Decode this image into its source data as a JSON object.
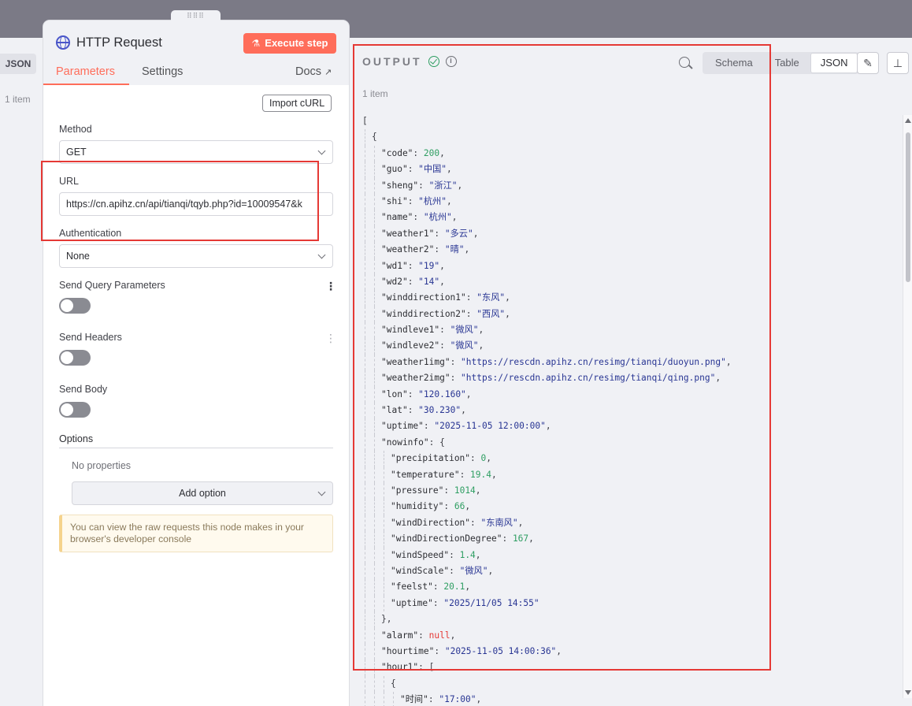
{
  "input_panel": {
    "json_tab": "JSON",
    "items": "1 item"
  },
  "node": {
    "title": "HTTP Request",
    "execute_label": "Execute step",
    "tabs": [
      "Parameters",
      "Settings"
    ],
    "docs_label": "Docs",
    "import_curl": "Import cURL",
    "method_label": "Method",
    "method_value": "GET",
    "url_label": "URL",
    "url_value": "https://cn.apihz.cn/api/tianqi/tqyb.php?id=10009547&k",
    "auth_label": "Authentication",
    "auth_value": "None",
    "query_label": "Send Query Parameters",
    "headers_label": "Send Headers",
    "body_label": "Send Body",
    "options_label": "Options",
    "no_properties": "No properties",
    "add_option": "Add option",
    "notice": "You can view the raw requests this node makes in your browser's developer console"
  },
  "output": {
    "title": "OUTPUT",
    "items": "1 item",
    "views": [
      "Schema",
      "Table",
      "JSON"
    ],
    "active_view": "JSON",
    "json_lines": [
      {
        "d": 0,
        "t": [
          [
            "[",
            "p"
          ]
        ]
      },
      {
        "d": 1,
        "t": [
          [
            "{",
            "p"
          ]
        ]
      },
      {
        "d": 2,
        "t": [
          [
            "\"code\"",
            "k"
          ],
          [
            ": ",
            "p"
          ],
          [
            "200",
            "n"
          ],
          [
            ",",
            "p"
          ]
        ]
      },
      {
        "d": 2,
        "t": [
          [
            "\"guo\"",
            "k"
          ],
          [
            ": ",
            "p"
          ],
          [
            "\"中国\"",
            "s"
          ],
          [
            ",",
            "p"
          ]
        ]
      },
      {
        "d": 2,
        "t": [
          [
            "\"sheng\"",
            "k"
          ],
          [
            ": ",
            "p"
          ],
          [
            "\"浙江\"",
            "s"
          ],
          [
            ",",
            "p"
          ]
        ]
      },
      {
        "d": 2,
        "t": [
          [
            "\"shi\"",
            "k"
          ],
          [
            ": ",
            "p"
          ],
          [
            "\"杭州\"",
            "s"
          ],
          [
            ",",
            "p"
          ]
        ]
      },
      {
        "d": 2,
        "t": [
          [
            "\"name\"",
            "k"
          ],
          [
            ": ",
            "p"
          ],
          [
            "\"杭州\"",
            "s"
          ],
          [
            ",",
            "p"
          ]
        ]
      },
      {
        "d": 2,
        "t": [
          [
            "\"weather1\"",
            "k"
          ],
          [
            ": ",
            "p"
          ],
          [
            "\"多云\"",
            "s"
          ],
          [
            ",",
            "p"
          ]
        ]
      },
      {
        "d": 2,
        "t": [
          [
            "\"weather2\"",
            "k"
          ],
          [
            ": ",
            "p"
          ],
          [
            "\"晴\"",
            "s"
          ],
          [
            ",",
            "p"
          ]
        ]
      },
      {
        "d": 2,
        "t": [
          [
            "\"wd1\"",
            "k"
          ],
          [
            ": ",
            "p"
          ],
          [
            "\"19\"",
            "s"
          ],
          [
            ",",
            "p"
          ]
        ]
      },
      {
        "d": 2,
        "t": [
          [
            "\"wd2\"",
            "k"
          ],
          [
            ": ",
            "p"
          ],
          [
            "\"14\"",
            "s"
          ],
          [
            ",",
            "p"
          ]
        ]
      },
      {
        "d": 2,
        "t": [
          [
            "\"winddirection1\"",
            "k"
          ],
          [
            ": ",
            "p"
          ],
          [
            "\"东风\"",
            "s"
          ],
          [
            ",",
            "p"
          ]
        ]
      },
      {
        "d": 2,
        "t": [
          [
            "\"winddirection2\"",
            "k"
          ],
          [
            ": ",
            "p"
          ],
          [
            "\"西风\"",
            "s"
          ],
          [
            ",",
            "p"
          ]
        ]
      },
      {
        "d": 2,
        "t": [
          [
            "\"windleve1\"",
            "k"
          ],
          [
            ": ",
            "p"
          ],
          [
            "\"微风\"",
            "s"
          ],
          [
            ",",
            "p"
          ]
        ]
      },
      {
        "d": 2,
        "t": [
          [
            "\"windleve2\"",
            "k"
          ],
          [
            ": ",
            "p"
          ],
          [
            "\"微风\"",
            "s"
          ],
          [
            ",",
            "p"
          ]
        ]
      },
      {
        "d": 2,
        "t": [
          [
            "\"weather1img\"",
            "k"
          ],
          [
            ": ",
            "p"
          ],
          [
            "\"https://rescdn.apihz.cn/resimg/tianqi/duoyun.png\"",
            "s"
          ],
          [
            ",",
            "p"
          ]
        ]
      },
      {
        "d": 2,
        "t": [
          [
            "\"weather2img\"",
            "k"
          ],
          [
            ": ",
            "p"
          ],
          [
            "\"https://rescdn.apihz.cn/resimg/tianqi/qing.png\"",
            "s"
          ],
          [
            ",",
            "p"
          ]
        ]
      },
      {
        "d": 2,
        "t": [
          [
            "\"lon\"",
            "k"
          ],
          [
            ": ",
            "p"
          ],
          [
            "\"120.160\"",
            "s"
          ],
          [
            ",",
            "p"
          ]
        ]
      },
      {
        "d": 2,
        "t": [
          [
            "\"lat\"",
            "k"
          ],
          [
            ": ",
            "p"
          ],
          [
            "\"30.230\"",
            "s"
          ],
          [
            ",",
            "p"
          ]
        ]
      },
      {
        "d": 2,
        "t": [
          [
            "\"uptime\"",
            "k"
          ],
          [
            ": ",
            "p"
          ],
          [
            "\"2025-11-05 12:00:00\"",
            "s"
          ],
          [
            ",",
            "p"
          ]
        ]
      },
      {
        "d": 2,
        "t": [
          [
            "\"nowinfo\"",
            "k"
          ],
          [
            ": ",
            "p"
          ],
          [
            "{",
            "p"
          ]
        ]
      },
      {
        "d": 3,
        "t": [
          [
            "\"precipitation\"",
            "k"
          ],
          [
            ": ",
            "p"
          ],
          [
            "0",
            "n"
          ],
          [
            ",",
            "p"
          ]
        ]
      },
      {
        "d": 3,
        "t": [
          [
            "\"temperature\"",
            "k"
          ],
          [
            ": ",
            "p"
          ],
          [
            "19.4",
            "n"
          ],
          [
            ",",
            "p"
          ]
        ]
      },
      {
        "d": 3,
        "t": [
          [
            "\"pressure\"",
            "k"
          ],
          [
            ": ",
            "p"
          ],
          [
            "1014",
            "n"
          ],
          [
            ",",
            "p"
          ]
        ]
      },
      {
        "d": 3,
        "t": [
          [
            "\"humidity\"",
            "k"
          ],
          [
            ": ",
            "p"
          ],
          [
            "66",
            "n"
          ],
          [
            ",",
            "p"
          ]
        ]
      },
      {
        "d": 3,
        "t": [
          [
            "\"windDirection\"",
            "k"
          ],
          [
            ": ",
            "p"
          ],
          [
            "\"东南风\"",
            "s"
          ],
          [
            ",",
            "p"
          ]
        ]
      },
      {
        "d": 3,
        "t": [
          [
            "\"windDirectionDegree\"",
            "k"
          ],
          [
            ": ",
            "p"
          ],
          [
            "167",
            "n"
          ],
          [
            ",",
            "p"
          ]
        ]
      },
      {
        "d": 3,
        "t": [
          [
            "\"windSpeed\"",
            "k"
          ],
          [
            ": ",
            "p"
          ],
          [
            "1.4",
            "n"
          ],
          [
            ",",
            "p"
          ]
        ]
      },
      {
        "d": 3,
        "t": [
          [
            "\"windScale\"",
            "k"
          ],
          [
            ": ",
            "p"
          ],
          [
            "\"微风\"",
            "s"
          ],
          [
            ",",
            "p"
          ]
        ]
      },
      {
        "d": 3,
        "t": [
          [
            "\"feelst\"",
            "k"
          ],
          [
            ": ",
            "p"
          ],
          [
            "20.1",
            "n"
          ],
          [
            ",",
            "p"
          ]
        ]
      },
      {
        "d": 3,
        "t": [
          [
            "\"uptime\"",
            "k"
          ],
          [
            ": ",
            "p"
          ],
          [
            "\"2025/11/05 14:55\"",
            "s"
          ]
        ]
      },
      {
        "d": 2,
        "t": [
          [
            "},",
            "p"
          ]
        ]
      },
      {
        "d": 2,
        "t": [
          [
            "\"alarm\"",
            "k"
          ],
          [
            ": ",
            "p"
          ],
          [
            "null",
            "nl"
          ],
          [
            ",",
            "p"
          ]
        ]
      },
      {
        "d": 2,
        "t": [
          [
            "\"hourtime\"",
            "k"
          ],
          [
            ": ",
            "p"
          ],
          [
            "\"2025-11-05 14:00:36\"",
            "s"
          ],
          [
            ",",
            "p"
          ]
        ]
      },
      {
        "d": 2,
        "t": [
          [
            "\"hour1\"",
            "k"
          ],
          [
            ": ",
            "p"
          ],
          [
            "[",
            "p"
          ]
        ]
      },
      {
        "d": 3,
        "t": [
          [
            "{",
            "p"
          ]
        ]
      },
      {
        "d": 4,
        "t": [
          [
            "\"时间\"",
            "k"
          ],
          [
            ": ",
            "p"
          ],
          [
            "\"17:00\"",
            "s"
          ],
          [
            ",",
            "p"
          ]
        ]
      }
    ]
  }
}
